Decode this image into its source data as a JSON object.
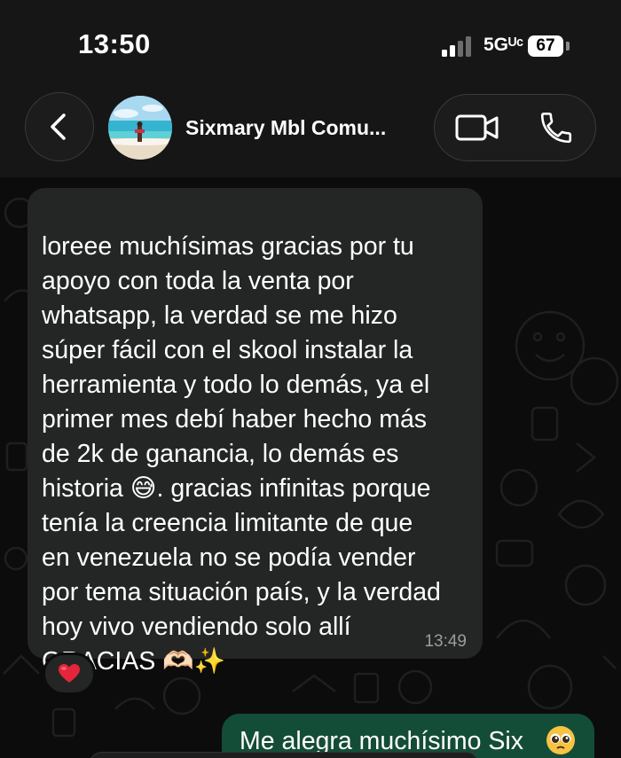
{
  "status_bar": {
    "time": "13:50",
    "network": "5Gᵁᶜ",
    "battery": "67"
  },
  "header": {
    "contact_name": "Sixmary Mbl Comu...",
    "icons": [
      "chevron-left-icon",
      "video-camera-icon",
      "phone-icon"
    ]
  },
  "messages": {
    "incoming": {
      "lines": [
        "loreee muchísimas gracias por tu",
        "apoyo con toda la venta por",
        "whatsapp, la verdad se me hizo",
        "súper fácil con el skool instalar la",
        "herramienta y todo lo demás, ya el",
        "primer mes debí haber hecho más",
        "de 2k de ganancia, lo demás es",
        "historia 😅. gracias infinitas porque",
        "tenía la creencia limitante de que",
        "en venezuela no se podía vender",
        "por tema situación país, y la verdad",
        "hoy vivo vendiendo solo allí",
        "GRACIAS 🫶🏻✨"
      ],
      "time": "13:49",
      "reaction": "❤️"
    },
    "outgoing": {
      "text": "Me alegra muchísimo Six",
      "emoji": "🥹"
    }
  },
  "colors": {
    "incoming_bubble": "#242626",
    "outgoing_bubble": "#144d37",
    "background": "#0c0c0c"
  }
}
